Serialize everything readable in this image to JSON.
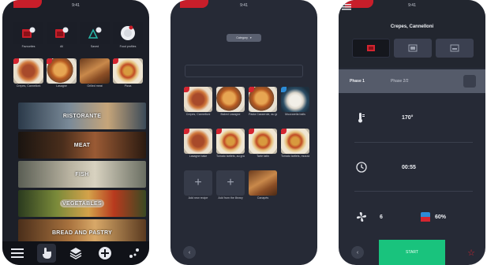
{
  "status_bar": {
    "time": "9:41"
  },
  "screen_home": {
    "program_tiles": [
      {
        "label": "Favourites",
        "icon": "steam-oven-icon"
      },
      {
        "label": "All",
        "icon": "steam-oven-icon"
      },
      {
        "label": "Saved",
        "icon": "oven-icon"
      },
      {
        "label": "Food profiles",
        "icon": "plate-icon"
      }
    ],
    "recent_recipes": [
      {
        "label": "Crepes, Cannelloni"
      },
      {
        "label": "Lasagne"
      },
      {
        "label": "Grilled meat"
      },
      {
        "label": "Pizza"
      }
    ],
    "categories": [
      {
        "label": "RISTORANTE"
      },
      {
        "label": "MEAT"
      },
      {
        "label": "FISH"
      },
      {
        "label": "VEGETABLES"
      },
      {
        "label": "BREAD AND PASTRY"
      }
    ],
    "tabbar": [
      {
        "name": "menu-icon",
        "active": false
      },
      {
        "name": "touch-icon",
        "active": true
      },
      {
        "name": "layers-icon",
        "active": false
      },
      {
        "name": "add-icon",
        "active": false
      },
      {
        "name": "settings-icon",
        "active": false
      }
    ]
  },
  "screen_recipes": {
    "filter_label": "Category",
    "recipes": [
      {
        "label": "Crepes, Cannelloni",
        "style": "alt2"
      },
      {
        "label": "Baked Lasagne",
        "style": ""
      },
      {
        "label": "Pasta Casserole, au gratin",
        "style": ""
      },
      {
        "label": "Mozzarella balls",
        "style": "alt3"
      },
      {
        "label": "Lasagne bake",
        "style": "alt2"
      },
      {
        "label": "Tomato tartlets, au gratin",
        "style": "alt4"
      },
      {
        "label": "Tarte tatin",
        "style": "alt4"
      },
      {
        "label": "Tomato tartlets, mozzarella",
        "style": "alt4"
      }
    ],
    "add_tiles": [
      {
        "label": "Add new recipe"
      },
      {
        "label": "Add from the library"
      }
    ],
    "extra_recipe": {
      "label": "Canapés"
    }
  },
  "screen_detail": {
    "title": "Crepes, Cannelloni",
    "phase_active": "Phase 1",
    "phase_next": "Phase 2/2",
    "temperature": "170°",
    "time": "00:55",
    "fan_level": "6",
    "humidity": "60%",
    "start_label": "START",
    "colors": {
      "accent": "#19c37d",
      "brand_red": "#d42530",
      "humidity_blue": "#2c8bd6"
    }
  }
}
